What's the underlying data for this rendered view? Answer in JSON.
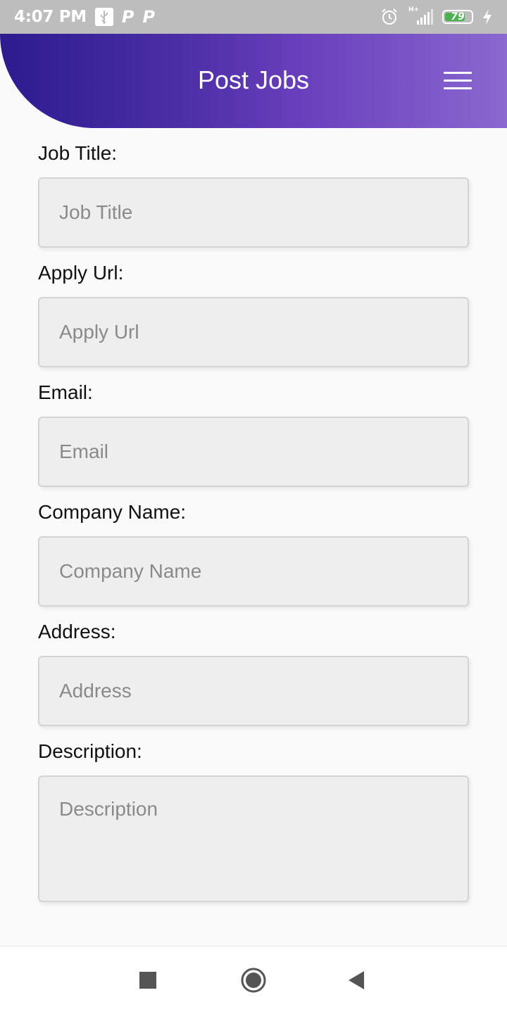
{
  "status_bar": {
    "time": "4:07 PM",
    "network_label": "H+",
    "battery_level": "79",
    "battery_percent": 79,
    "icons": [
      "usb-icon",
      "p-app-icon",
      "p-app-icon",
      "alarm-icon",
      "signal-icon",
      "battery-icon",
      "charging-icon"
    ]
  },
  "header": {
    "title": "Post Jobs",
    "menu_icon": "hamburger-menu-icon",
    "gradient_start": "#2d1b8f",
    "gradient_end": "#8a68cf"
  },
  "form": {
    "fields": [
      {
        "label": "Job Title:",
        "placeholder": "Job Title",
        "value": ""
      },
      {
        "label": "Apply Url:",
        "placeholder": "Apply Url",
        "value": ""
      },
      {
        "label": "Email:",
        "placeholder": "Email",
        "value": ""
      },
      {
        "label": "Company Name:",
        "placeholder": "Company Name",
        "value": ""
      },
      {
        "label": "Address:",
        "placeholder": "Address",
        "value": ""
      },
      {
        "label": "Description:",
        "placeholder": "Description",
        "value": ""
      }
    ]
  },
  "nav_bar": {
    "icons": [
      "recents-square-icon",
      "home-circle-icon",
      "back-triangle-icon"
    ]
  }
}
